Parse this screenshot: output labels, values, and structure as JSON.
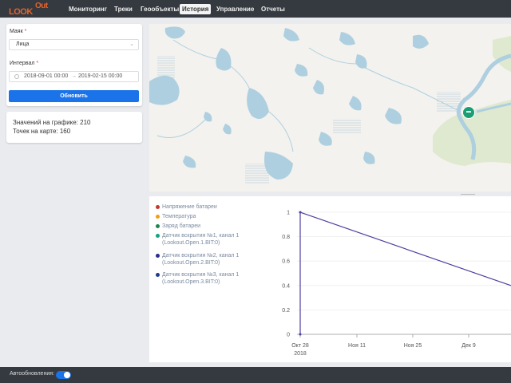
{
  "app": {
    "logo_look": "LOOK",
    "logo_out": "Out",
    "brand_color": "#e8622a",
    "accent_color": "#1a73e8"
  },
  "nav": {
    "items": [
      {
        "label": "Мониторинг",
        "active": false
      },
      {
        "label": "Треки",
        "active": false
      },
      {
        "label": "Геообъекты",
        "active": false
      },
      {
        "label": "История",
        "active": true
      },
      {
        "label": "Управление",
        "active": false
      },
      {
        "label": "Отчеты",
        "active": false
      }
    ]
  },
  "filter": {
    "beacon_label": "Маяк",
    "beacon_value": "Лица",
    "interval_label": "Интервал",
    "date_from": "2018-09-01 00:00",
    "date_to": "2019-02-15 00:00",
    "refresh_button": "Обновить"
  },
  "stats": {
    "chart_values": "Значений на графике: 210",
    "map_points": "Точек на карте: 160"
  },
  "map": {
    "marker_icon": "car-marker-icon",
    "marker_color": "#1a9e74"
  },
  "legend": [
    {
      "line1": "Напряжение батареи",
      "line2": "",
      "color": "#c0392b"
    },
    {
      "line1": "Температура",
      "line2": "",
      "color": "#f39c12"
    },
    {
      "line1": "Заряд батареи",
      "line2": "",
      "color": "#1e8449"
    },
    {
      "line1": "Датчик вскрытия №1, канал 1",
      "line2": "(Lookout.Open.1.BIT:0)",
      "color": "#16a085"
    },
    {
      "line1": "Датчик вскрытия №2, канал 1",
      "line2": "(Lookout.Open.2.BIT:0)",
      "color": "#2c2c8c"
    },
    {
      "line1": "Датчик вскрытия №3, канал 1",
      "line2": "(Lookout.Open.3.BIT:0)",
      "color": "#1f3a93"
    }
  ],
  "chart_data": {
    "type": "line",
    "x": [
      "2018-10-28",
      "2018-10-28",
      "2019-01-01"
    ],
    "series": [
      {
        "values": [
          0,
          1,
          0.25
        ]
      }
    ],
    "x_ticks": [
      "Окт 28",
      "Ноя 11",
      "Ноя 25",
      "Дек 9"
    ],
    "x_tick_sub": [
      "2018",
      "",
      "",
      ""
    ],
    "y_ticks": [
      "0",
      "0.2",
      "0.4",
      "0.6",
      "0.8",
      "1"
    ],
    "ylim": [
      0,
      1
    ],
    "line_color": "#4b3f9e"
  },
  "footer": {
    "autoupdate_label": "Автообновления:",
    "autoupdate_on": true
  }
}
